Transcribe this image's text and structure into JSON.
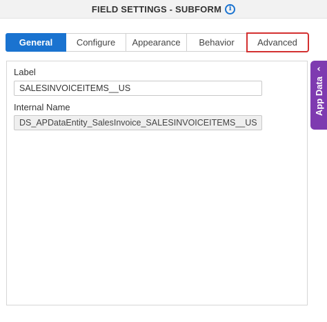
{
  "header": {
    "title": "FIELD SETTINGS - SUBFORM",
    "info_glyph": "i",
    "info_icon": "info-circle-icon"
  },
  "tabs": [
    {
      "label": "General",
      "active": true
    },
    {
      "label": "Configure",
      "active": false
    },
    {
      "label": "Appearance",
      "active": false
    },
    {
      "label": "Behavior",
      "active": false
    },
    {
      "label": "Advanced",
      "active": false,
      "highlighted": true
    }
  ],
  "fields": {
    "label": {
      "caption": "Label",
      "value": "SALESINVOICEITEMS__US"
    },
    "internal_name": {
      "caption": "Internal Name",
      "value": "DS_APDataEntity_SalesInvoice_SALESINVOICEITEMS__US",
      "readonly": true
    }
  },
  "side_panel": {
    "label": "App Data",
    "chevron": "‹",
    "chevron_icon": "chevron-left-icon"
  },
  "colors": {
    "accent": "#1a73d0",
    "highlight": "#d32f2f",
    "side_panel": "#7e3bb0"
  }
}
